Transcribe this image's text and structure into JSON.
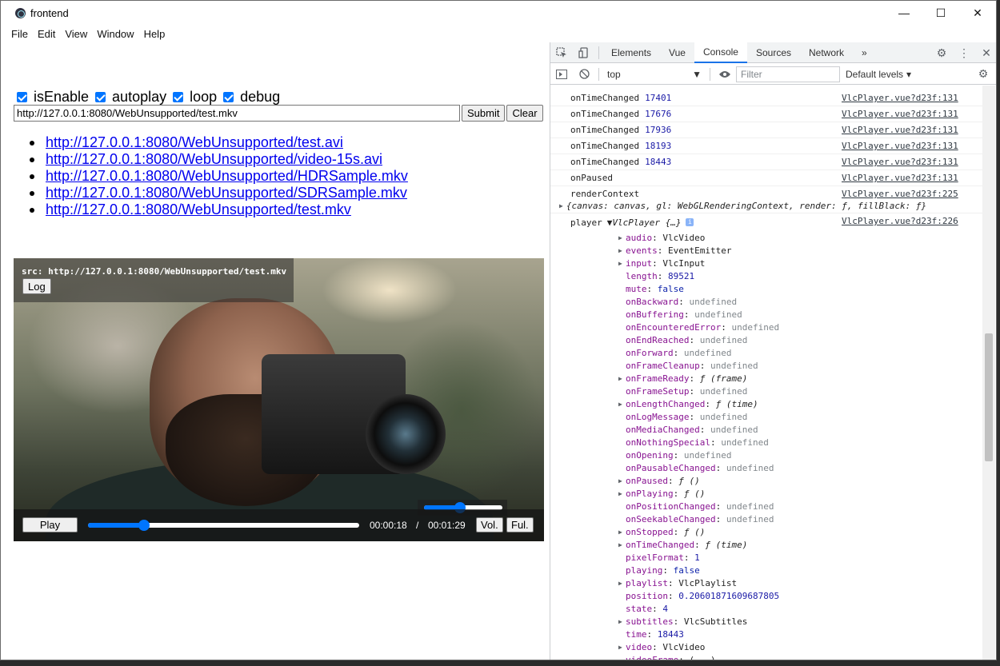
{
  "window": {
    "title": "frontend",
    "controls": [
      "—",
      "☐",
      "✕"
    ]
  },
  "menu": [
    "File",
    "Edit",
    "View",
    "Window",
    "Help"
  ],
  "options": [
    {
      "label": "isEnable",
      "checked": true
    },
    {
      "label": "autoplay",
      "checked": true
    },
    {
      "label": "loop",
      "checked": true
    },
    {
      "label": "debug",
      "checked": true
    }
  ],
  "url_form": {
    "value": "http://127.0.0.1:8080/WebUnsupported/test.mkv",
    "submit": "Submit",
    "clear": "Clear"
  },
  "links": [
    "http://127.0.0.1:8080/WebUnsupported/test.avi",
    "http://127.0.0.1:8080/WebUnsupported/video-15s.avi",
    "http://127.0.0.1:8080/WebUnsupported/HDRSample.mkv",
    "http://127.0.0.1:8080/WebUnsupported/SDRSample.mkv",
    "http://127.0.0.1:8080/WebUnsupported/test.mkv"
  ],
  "player": {
    "src_label": "src: http://127.0.0.1:8080/WebUnsupported/test.mkv",
    "log_button": "Log",
    "play_button": "Play",
    "progress_fraction": 0.206,
    "volume_fraction": 0.46,
    "current_time": "00:00:18",
    "separator": "/",
    "duration": "00:01:29",
    "vol_button": "Vol.",
    "full_button": "Ful."
  },
  "devtools": {
    "tabs": [
      "Elements",
      "Vue",
      "Console",
      "Sources",
      "Network"
    ],
    "active_tab": "Console",
    "more_tabs": "»",
    "context": "top",
    "filter_placeholder": "Filter",
    "levels": "Default levels",
    "logs": [
      {
        "msg": "onTimeChanged",
        "value": "17401",
        "source": "VlcPlayer.vue?d23f:131"
      },
      {
        "msg": "onTimeChanged",
        "value": "17676",
        "source": "VlcPlayer.vue?d23f:131"
      },
      {
        "msg": "onTimeChanged",
        "value": "17936",
        "source": "VlcPlayer.vue?d23f:131"
      },
      {
        "msg": "onTimeChanged",
        "value": "18193",
        "source": "VlcPlayer.vue?d23f:131"
      },
      {
        "msg": "onTimeChanged",
        "value": "18443",
        "source": "VlcPlayer.vue?d23f:131"
      },
      {
        "msg": "onPaused",
        "value": "",
        "source": "VlcPlayer.vue?d23f:131"
      }
    ],
    "render_context": {
      "msg": "renderContext",
      "source": "VlcPlayer.vue?d23f:225",
      "object": "{canvas: canvas, gl: WebGLRenderingContext, render: ƒ, fillBlack: ƒ}"
    },
    "player_log": {
      "msg": "player",
      "header": "▼VlcPlayer {…}",
      "source": "VlcPlayer.vue?d23f:226",
      "props": [
        {
          "k": "audio",
          "v": "VlcVideo",
          "t": "obj",
          "exp": true
        },
        {
          "k": "events",
          "v": "EventEmitter",
          "t": "obj",
          "exp": true
        },
        {
          "k": "input",
          "v": "VlcInput",
          "t": "obj",
          "exp": true
        },
        {
          "k": "length",
          "v": "89521",
          "t": "num",
          "exp": false
        },
        {
          "k": "mute",
          "v": "false",
          "t": "kw",
          "exp": false
        },
        {
          "k": "onBackward",
          "v": "undefined",
          "t": "undef",
          "exp": false
        },
        {
          "k": "onBuffering",
          "v": "undefined",
          "t": "undef",
          "exp": false
        },
        {
          "k": "onEncounteredError",
          "v": "undefined",
          "t": "undef",
          "exp": false
        },
        {
          "k": "onEndReached",
          "v": "undefined",
          "t": "undef",
          "exp": false
        },
        {
          "k": "onForward",
          "v": "undefined",
          "t": "undef",
          "exp": false
        },
        {
          "k": "onFrameCleanup",
          "v": "undefined",
          "t": "undef",
          "exp": false
        },
        {
          "k": "onFrameReady",
          "v": "ƒ (frame)",
          "t": "fn",
          "exp": true
        },
        {
          "k": "onFrameSetup",
          "v": "undefined",
          "t": "undef",
          "exp": false
        },
        {
          "k": "onLengthChanged",
          "v": "ƒ (time)",
          "t": "fn",
          "exp": true
        },
        {
          "k": "onLogMessage",
          "v": "undefined",
          "t": "undef",
          "exp": false
        },
        {
          "k": "onMediaChanged",
          "v": "undefined",
          "t": "undef",
          "exp": false
        },
        {
          "k": "onNothingSpecial",
          "v": "undefined",
          "t": "undef",
          "exp": false
        },
        {
          "k": "onOpening",
          "v": "undefined",
          "t": "undef",
          "exp": false
        },
        {
          "k": "onPausableChanged",
          "v": "undefined",
          "t": "undef",
          "exp": false
        },
        {
          "k": "onPaused",
          "v": "ƒ ()",
          "t": "fn",
          "exp": true
        },
        {
          "k": "onPlaying",
          "v": "ƒ ()",
          "t": "fn",
          "exp": true
        },
        {
          "k": "onPositionChanged",
          "v": "undefined",
          "t": "undef",
          "exp": false
        },
        {
          "k": "onSeekableChanged",
          "v": "undefined",
          "t": "undef",
          "exp": false
        },
        {
          "k": "onStopped",
          "v": "ƒ ()",
          "t": "fn",
          "exp": true
        },
        {
          "k": "onTimeChanged",
          "v": "ƒ (time)",
          "t": "fn",
          "exp": true
        },
        {
          "k": "pixelFormat",
          "v": "1",
          "t": "num",
          "exp": false
        },
        {
          "k": "playing",
          "v": "false",
          "t": "kw",
          "exp": false
        },
        {
          "k": "playlist",
          "v": "VlcPlaylist",
          "t": "obj",
          "exp": true
        },
        {
          "k": "position",
          "v": "0.206018716096878​05",
          "t": "num",
          "exp": false
        },
        {
          "k": "state",
          "v": "4",
          "t": "num",
          "exp": false
        },
        {
          "k": "subtitles",
          "v": "VlcSubtitles",
          "t": "obj",
          "exp": true
        },
        {
          "k": "time",
          "v": "18443",
          "t": "num",
          "exp": false
        },
        {
          "k": "video",
          "v": "VlcVideo",
          "t": "obj",
          "exp": true
        },
        {
          "k": "videoFrame",
          "v": "(...)",
          "t": "obj",
          "exp": false
        }
      ]
    }
  },
  "colors": {
    "accent": "#0075ff",
    "link": "#0000ee",
    "devtools_active": "#1a73e8"
  }
}
